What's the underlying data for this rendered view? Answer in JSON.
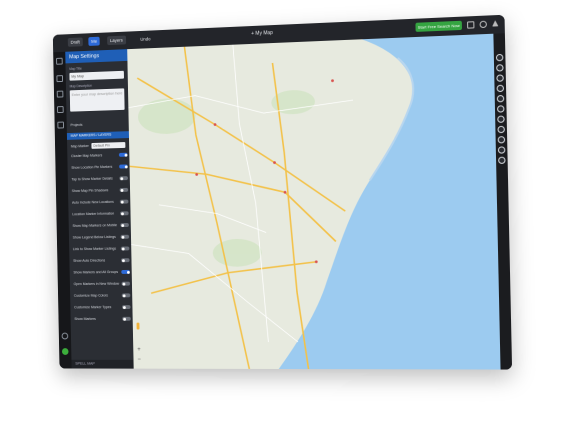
{
  "topbar": {
    "left_buttons": [
      "Draft",
      "Me",
      "Layers"
    ],
    "undo_label": "Undo",
    "title": "+ My Map",
    "cta_label": "Start Free Search Now"
  },
  "panel": {
    "header": "Map Settings",
    "name_label": "Map Title",
    "name_value": "My Map",
    "desc_label": "Map Description",
    "desc_placeholder": "Enter your map description here",
    "project_row": "Projects",
    "section": "MAP MARKERS / LAYERS",
    "marker_label": "Map Marker",
    "marker_value": "Default Pin",
    "rows": [
      {
        "label": "Cluster Map Markers",
        "on": true
      },
      {
        "label": "Show Location Pin Markers",
        "on": true
      },
      {
        "label": "Tap to Show Marker Details",
        "on": false
      },
      {
        "label": "Show Map Pin Shadows",
        "on": false
      },
      {
        "label": "Auto Include New Locations",
        "on": false
      },
      {
        "label": "Location Marker Information",
        "on": false
      },
      {
        "label": "Show Map Markers on Mobile",
        "on": false
      },
      {
        "label": "Show Legend Below Listings",
        "on": false
      },
      {
        "label": "Link to Show Marker Listings",
        "on": false
      },
      {
        "label": "Show Auto Directions",
        "on": false
      },
      {
        "label": "Show Markers and All Groups",
        "on": true
      },
      {
        "label": "Open Markers in New Window",
        "on": false
      },
      {
        "label": "Customize Map Colors",
        "on": false
      },
      {
        "label": "Customize Marker Types",
        "on": false
      },
      {
        "label": "Show Markers",
        "on": false
      }
    ],
    "footer": "SPELL MAP"
  },
  "map": {
    "colors": {
      "land": "#e7eadf",
      "water": "#9ccbf0",
      "road": "#f3c24a",
      "minor": "#ffffff",
      "green": "#cfe3c0"
    },
    "zoom_in": "+",
    "zoom_out": "−"
  }
}
